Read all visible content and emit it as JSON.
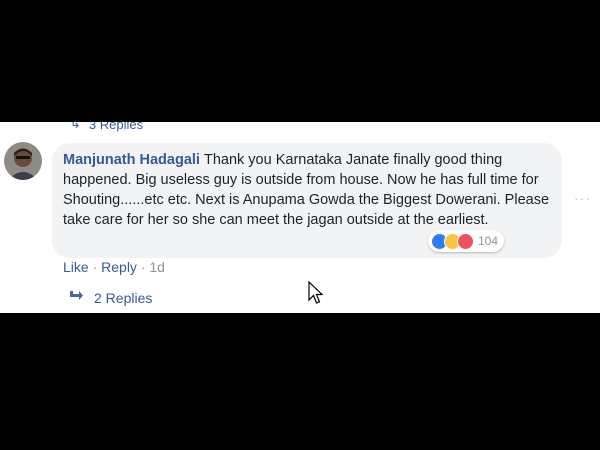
{
  "previous_replies": {
    "icon": "reply-arrow-icon",
    "label": "3 Replies"
  },
  "comment": {
    "author": "Manjunath Hadagali",
    "text": "Thank you Karnataka Janate finally good thing happened. Big useless guy is outside from house. Now he has full time for Shouting......etc etc. Next is Anupama Gowda the Biggest Dowerani. Please take care for her so she can meet the jagan outside at the earliest.",
    "reactions": {
      "icons": [
        "like-icon",
        "haha-icon",
        "angry-icon"
      ],
      "count": "104"
    },
    "actions": {
      "like": "Like",
      "sep1": " · ",
      "reply": "Reply",
      "sep2": " · ",
      "time": "1d"
    },
    "replies": {
      "icon": "reply-arrow-icon",
      "label": "2 Replies"
    },
    "more_icon": "more-options-icon"
  },
  "colors": {
    "link": "#385898",
    "bubble": "#f2f3f5",
    "like": "#2f7df6",
    "haha": "#f7c640",
    "angry": "#f0505e"
  }
}
